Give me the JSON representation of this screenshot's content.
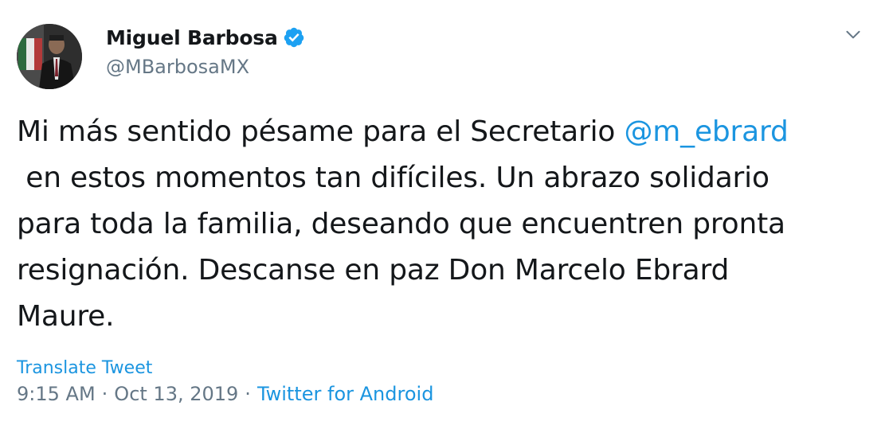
{
  "user": {
    "display_name": "Miguel Barbosa",
    "handle": "@MBarbosaMX",
    "verified": true
  },
  "tweet": {
    "lines": [
      {
        "before": "Mi más sentido pésame para el Secretario ",
        "mention": "@m_ebrard"
      },
      {
        "text": " en estos momentos tan difíciles. Un abrazo solidario"
      },
      {
        "text": "para toda la familia, deseando que encuentren pronta"
      },
      {
        "text": "resignación. Descanse en paz Don Marcelo Ebrard"
      },
      {
        "text": "Maure."
      }
    ]
  },
  "translate_label": "Translate Tweet",
  "meta": {
    "time": "9:15 AM",
    "separator": "·",
    "date": "Oct 13, 2019",
    "source": "Twitter for Android"
  },
  "icons": {
    "verified": "verified-badge-icon",
    "caret": "chevron-down-icon"
  },
  "colors": {
    "link": "#1b95e0",
    "muted": "#657786",
    "text": "#14171a",
    "verified": "#1da1f2"
  }
}
